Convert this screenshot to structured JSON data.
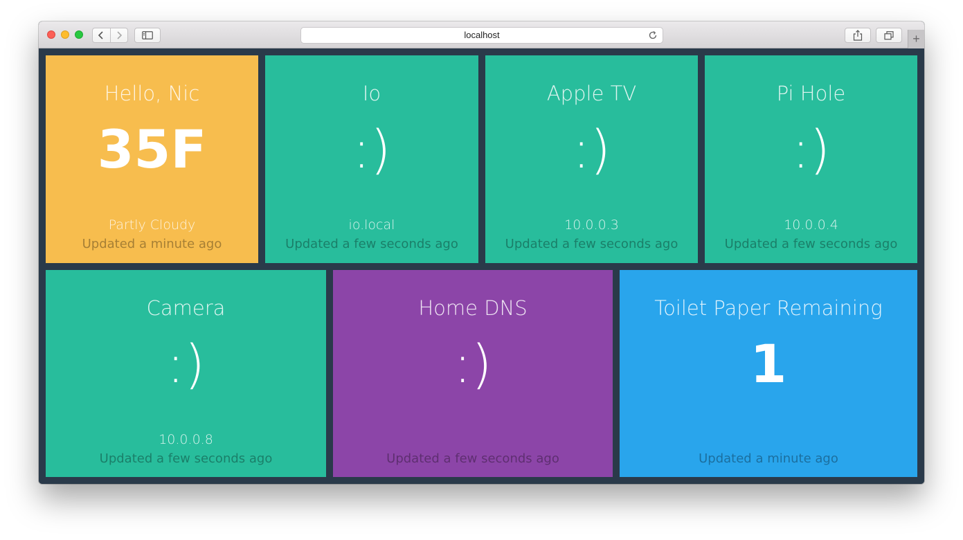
{
  "browser": {
    "url": "localhost",
    "new_tab_label": "+"
  },
  "tiles": [
    {
      "title": "Hello, Nic",
      "value": "35F",
      "subtitle": "Partly Cloudy",
      "updated": "Updated a minute ago",
      "color": "#f7bd4e"
    },
    {
      "title": "Io",
      "value": ":)",
      "subtitle": "io.local",
      "updated": "Updated a few seconds ago",
      "color": "#28bd9c"
    },
    {
      "title": "Apple TV",
      "value": ":)",
      "subtitle": "10.0.0.3",
      "updated": "Updated a few seconds ago",
      "color": "#28bd9c"
    },
    {
      "title": "Pi Hole",
      "value": ":)",
      "subtitle": "10.0.0.4",
      "updated": "Updated a few seconds ago",
      "color": "#28bd9c"
    },
    {
      "title": "Camera",
      "value": ":)",
      "subtitle": "10.0.0.8",
      "updated": "Updated a few seconds ago",
      "color": "#28bd9c"
    },
    {
      "title": "Home DNS",
      "value": ":)",
      "subtitle": "",
      "updated": "Updated a few seconds ago",
      "color": "#8c45a8"
    },
    {
      "title": "Toilet Paper Remaining",
      "value": "1",
      "subtitle": "",
      "updated": "Updated a minute ago",
      "color": "#29a5ec"
    }
  ]
}
